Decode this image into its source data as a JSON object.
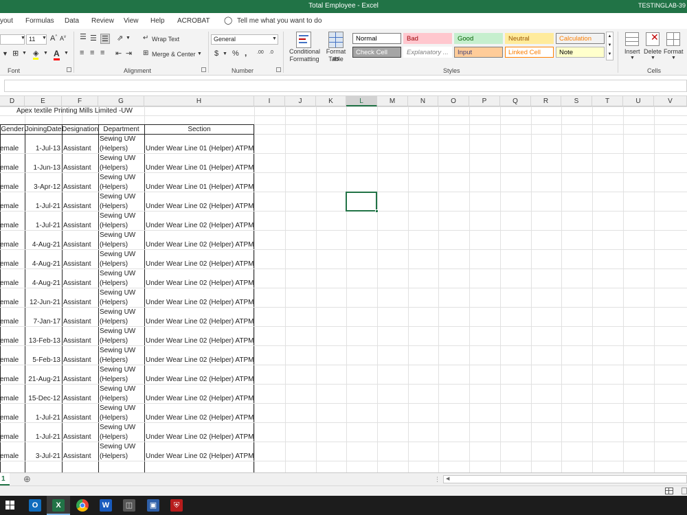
{
  "window": {
    "title": "Total Employee  -  Excel",
    "user": "TESTINGLAB-39"
  },
  "ribbon_tabs": [
    "yout",
    "Formulas",
    "Data",
    "Review",
    "View",
    "Help",
    "ACROBAT"
  ],
  "tell_me": "Tell me what you want to do",
  "font": {
    "size": "11",
    "group_label": "Font"
  },
  "alignment": {
    "wrap_text": "Wrap Text",
    "merge_center": "Merge & Center",
    "group_label": "Alignment"
  },
  "number": {
    "format": "General",
    "currency": "$",
    "percent": "%",
    "comma": ",",
    "inc_dec": ".00",
    "dec_dec": ".0",
    "group_label": "Number"
  },
  "styles": {
    "conditional_formatting": [
      "Conditional",
      "Formatting"
    ],
    "format_as_table": [
      "Format as",
      "Table"
    ],
    "cells": [
      {
        "label": "Normal",
        "bg": "#ffffff",
        "fg": "#000000",
        "border": "#7a7a7a"
      },
      {
        "label": "Bad",
        "bg": "#ffc7ce",
        "fg": "#9c0006",
        "border": "#ffc7ce"
      },
      {
        "label": "Good",
        "bg": "#c6efce",
        "fg": "#006100",
        "border": "#c6efce"
      },
      {
        "label": "Neutral",
        "bg": "#ffeb9c",
        "fg": "#9c5700",
        "border": "#ffeb9c"
      },
      {
        "label": "Calculation",
        "bg": "#f2f2f2",
        "fg": "#fa7d00",
        "border": "#7f7f7f"
      },
      {
        "label": "Check Cell",
        "bg": "#a5a5a5",
        "fg": "#ffffff",
        "border": "#3f3f3f"
      },
      {
        "label": "Explanatory ...",
        "bg": "#ffffff",
        "fg": "#7f7f7f",
        "border": "#ffffff"
      },
      {
        "label": "Input",
        "bg": "#ffcc99",
        "fg": "#3f3f76",
        "border": "#7f7f7f"
      },
      {
        "label": "Linked Cell",
        "bg": "#ffffff",
        "fg": "#fa7d00",
        "border": "#ff8001"
      },
      {
        "label": "Note",
        "bg": "#ffffcc",
        "fg": "#000000",
        "border": "#b2b2b2"
      }
    ],
    "group_label": "Styles"
  },
  "cells_group": {
    "insert": "Insert",
    "delete": "Delete",
    "format": "Format",
    "group_label": "Cells"
  },
  "columns": [
    "D",
    "E",
    "F",
    "G",
    "H",
    "I",
    "J",
    "K",
    "L",
    "M",
    "N",
    "O",
    "P",
    "Q",
    "R",
    "S",
    "T",
    "U",
    "V"
  ],
  "selected_column": "L",
  "sheet": {
    "company_title": "Apex textile Printing Mills Limited -UW",
    "headers": [
      "Gender",
      "JoiningDate",
      "Designation",
      "Department",
      "Section"
    ],
    "rows": [
      {
        "gender": "emale",
        "date": "1-Jul-13",
        "designation": "Assistant",
        "dept1": "Sewing UW",
        "dept2": "(Helpers)",
        "section": "Under Wear  Line 01 (Helper) ATPML"
      },
      {
        "gender": "emale",
        "date": "1-Jun-13",
        "designation": "Assistant",
        "dept1": "Sewing UW",
        "dept2": "(Helpers)",
        "section": "Under Wear  Line 01 (Helper) ATPML"
      },
      {
        "gender": "emale",
        "date": "3-Apr-12",
        "designation": "Assistant",
        "dept1": "Sewing UW",
        "dept2": "(Helpers)",
        "section": "Under Wear  Line 01 (Helper) ATPML"
      },
      {
        "gender": "emale",
        "date": "1-Jul-21",
        "designation": "Assistant",
        "dept1": "Sewing UW",
        "dept2": "(Helpers)",
        "section": "Under Wear  Line 02 (Helper) ATPML"
      },
      {
        "gender": "emale",
        "date": "1-Jul-21",
        "designation": "Assistant",
        "dept1": "Sewing UW",
        "dept2": "(Helpers)",
        "section": "Under Wear  Line 02 (Helper) ATPML"
      },
      {
        "gender": "emale",
        "date": "4-Aug-21",
        "designation": "Assistant",
        "dept1": "Sewing UW",
        "dept2": "(Helpers)",
        "section": "Under Wear  Line 02 (Helper) ATPML"
      },
      {
        "gender": "emale",
        "date": "4-Aug-21",
        "designation": "Assistant",
        "dept1": "Sewing UW",
        "dept2": "(Helpers)",
        "section": "Under Wear  Line 02 (Helper) ATPML"
      },
      {
        "gender": "emale",
        "date": "4-Aug-21",
        "designation": "Assistant",
        "dept1": "Sewing UW",
        "dept2": "(Helpers)",
        "section": "Under Wear  Line 02 (Helper) ATPML"
      },
      {
        "gender": "emale",
        "date": "12-Jun-21",
        "designation": "Assistant",
        "dept1": "Sewing UW",
        "dept2": "(Helpers)",
        "section": "Under Wear  Line 02 (Helper) ATPML"
      },
      {
        "gender": "emale",
        "date": "7-Jan-17",
        "designation": "Assistant",
        "dept1": "Sewing UW",
        "dept2": "(Helpers)",
        "section": "Under Wear  Line 02 (Helper) ATPML"
      },
      {
        "gender": "emale",
        "date": "13-Feb-13",
        "designation": "Assistant",
        "dept1": "Sewing UW",
        "dept2": "(Helpers)",
        "section": "Under Wear  Line 02 (Helper) ATPML"
      },
      {
        "gender": "emale",
        "date": "5-Feb-13",
        "designation": "Assistant",
        "dept1": "Sewing UW",
        "dept2": "(Helpers)",
        "section": "Under Wear  Line 02 (Helper) ATPML"
      },
      {
        "gender": "emale",
        "date": "21-Aug-21",
        "designation": "Assistant",
        "dept1": "Sewing UW",
        "dept2": "(Helpers)",
        "section": "Under Wear  Line 02 (Helper) ATPML"
      },
      {
        "gender": "emale",
        "date": "15-Dec-12",
        "designation": "Assistant",
        "dept1": "Sewing UW",
        "dept2": "(Helpers)",
        "section": "Under Wear  Line 02 (Helper) ATPML"
      },
      {
        "gender": "emale",
        "date": "1-Jul-21",
        "designation": "Assistant",
        "dept1": "Sewing UW",
        "dept2": "(Helpers)",
        "section": "Under Wear  Line 02 (Helper) ATPML"
      },
      {
        "gender": "emale",
        "date": "1-Jul-21",
        "designation": "Assistant",
        "dept1": "Sewing UW",
        "dept2": "(Helpers)",
        "section": "Under Wear  Line 02 (Helper) ATPML"
      },
      {
        "gender": "emale",
        "date": "3-Jul-21",
        "designation": "Assistant",
        "dept1": "Sewing UW",
        "dept2": "(Helpers)",
        "section": "Under Wear  Line 02 (Helper) ATPML"
      }
    ]
  },
  "sheet_tab": "1",
  "add_sheet": "⊕"
}
